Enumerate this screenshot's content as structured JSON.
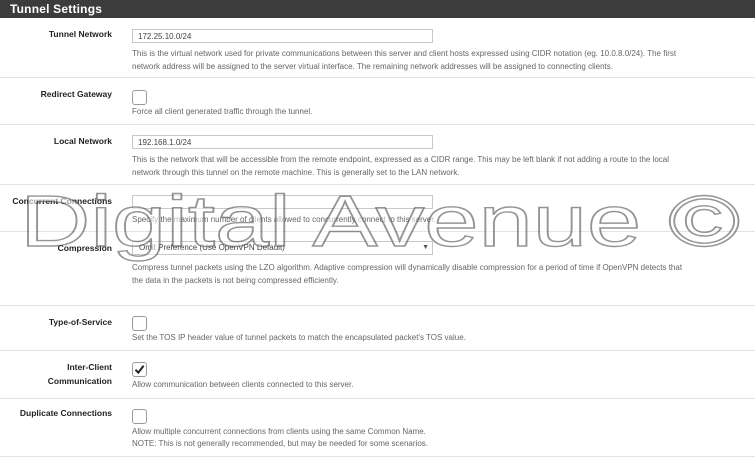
{
  "section": {
    "title": "Tunnel Settings"
  },
  "fields": {
    "tunnel_network": {
      "label": "Tunnel Network",
      "value": "172.25.10.0/24",
      "help_1": "This is the virtual network used for private communications between this server and client hosts expressed using CIDR notation (eg. 10.0.8.0/24). The first",
      "help_2": "network address will be assigned to the server virtual interface. The remaining network addresses will be assigned to connecting clients."
    },
    "redirect_gateway": {
      "label": "Redirect Gateway",
      "checked": false,
      "help": "Force all client generated traffic through the tunnel."
    },
    "local_network": {
      "label": "Local Network",
      "value": "192.168.1.0/24",
      "help_1": "This is the network that will be accessible from the remote endpoint, expressed as a CIDR range. This may be left blank if not adding a route to the local",
      "help_2": "network through this tunnel on the remote machine. This is generally set to the LAN network."
    },
    "concurrent_connections": {
      "label": "Concurrent Connections",
      "value": "",
      "help": "Specify the maximum number of clients allowed to concurrently connect to this server."
    },
    "compression": {
      "label": "Compression",
      "selected": "Omit Preference (Use OpenVPN Default)",
      "help_1": "Compress tunnel packets using the LZO algorithm. Adaptive compression will dynamically disable compression for a period of time if OpenVPN detects that",
      "help_2": "the data in the packets is not being compressed efficiently."
    },
    "type_of_service": {
      "label": "Type-of-Service",
      "checked": false,
      "help": "Set the TOS IP header value of tunnel packets to match the encapsulated packet's TOS value."
    },
    "inter_client": {
      "label_1": "Inter-Client",
      "label_2": "Communication",
      "checked": true,
      "help": "Allow communication between clients connected to this server."
    },
    "duplicate_connections": {
      "label": "Duplicate Connections",
      "checked": false,
      "help_1": "Allow multiple concurrent connections from clients using the same Common Name.",
      "help_2": "NOTE: This is not generally recommended, but may be needed for some scenarios."
    }
  },
  "watermark": {
    "text": "Digital Avenue ©"
  },
  "colors": {
    "header_bg": "#3c3c3c",
    "border": "#e3e3e3",
    "help_text": "#666666"
  }
}
